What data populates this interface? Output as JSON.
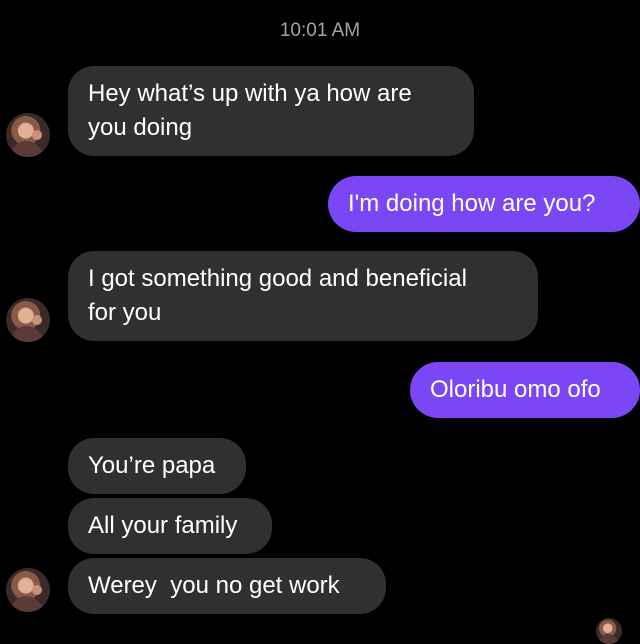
{
  "thread": {
    "timestamp": "10:01 AM",
    "messages": [
      {
        "direction": "incoming",
        "text": "Hey what’s up with ya how are\nyou doing"
      },
      {
        "direction": "outgoing",
        "text": "I'm doing how are you?"
      },
      {
        "direction": "incoming",
        "text": "I got something good and beneficial\nfor you"
      },
      {
        "direction": "outgoing",
        "text": "Oloribu omo ofo"
      },
      {
        "direction": "incoming",
        "text": "You’re papa"
      },
      {
        "direction": "incoming",
        "text": "All your family"
      },
      {
        "direction": "incoming",
        "text": "Werey  you no get work"
      }
    ]
  },
  "colors": {
    "background": "#000000",
    "incoming_bubble": "#303033",
    "outgoing_bubble": "#7b47f5",
    "timestamp": "#a3a3a8"
  },
  "icons": {
    "contact_avatar": "contact-avatar-photo",
    "read_receipt_avatar": "read-receipt-avatar-photo"
  }
}
